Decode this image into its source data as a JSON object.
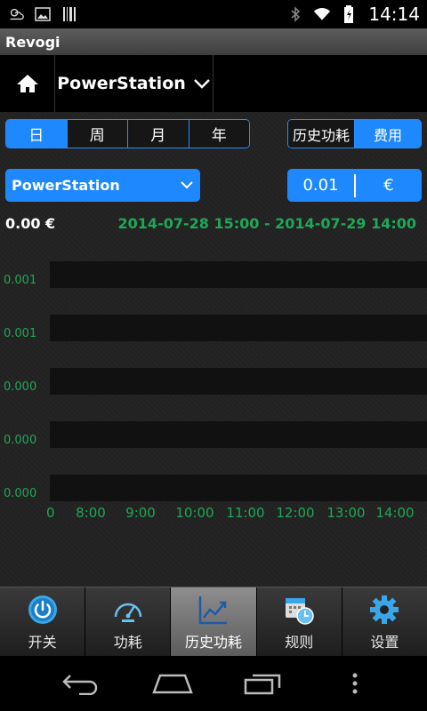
{
  "status_bar": {
    "time": "14:14",
    "icons": [
      "weather-icon",
      "image-icon",
      "barcode-icon",
      "bluetooth-icon",
      "wifi-icon",
      "battery-icon"
    ]
  },
  "app": {
    "title": "Revogi"
  },
  "toolbar": {
    "device_name": "PowerStation"
  },
  "period_tabs": [
    {
      "label": "日",
      "active": true
    },
    {
      "label": "周",
      "active": false
    },
    {
      "label": "月",
      "active": false
    },
    {
      "label": "年",
      "active": false
    }
  ],
  "mode_tabs": [
    {
      "label": "历史功耗",
      "active": false
    },
    {
      "label": "费用",
      "active": true
    }
  ],
  "device_dropdown": {
    "selected": "PowerStation"
  },
  "price": {
    "value": "0.01",
    "currency": "€"
  },
  "summary": {
    "total": "0.00 €",
    "range": "2014-07-28 15:00 - 2014-07-29 14:00"
  },
  "chart_data": {
    "type": "bar",
    "ytick_labels": [
      "0.001",
      "0.001",
      "0.000",
      "0.000",
      "0.000"
    ],
    "xtick_labels": [
      "0",
      "8:00",
      "9:00",
      "10:00",
      "11:00",
      "12:00",
      "13:00",
      "14:00"
    ],
    "values": [
      0,
      0,
      0,
      0,
      0,
      0,
      0,
      0
    ],
    "colors": {
      "axis_text": "#1fa855",
      "band": "#111111"
    }
  },
  "tabs": [
    {
      "label": "开关",
      "icon": "power-icon",
      "active": false
    },
    {
      "label": "功耗",
      "icon": "speedometer-icon",
      "active": false
    },
    {
      "label": "历史功耗",
      "icon": "line-chart-icon",
      "active": true
    },
    {
      "label": "规则",
      "icon": "calendar-clock-icon",
      "active": false
    },
    {
      "label": "设置",
      "icon": "gear-icon",
      "active": false
    }
  ],
  "colors": {
    "accent": "#1e88ff",
    "green": "#1fa855"
  }
}
